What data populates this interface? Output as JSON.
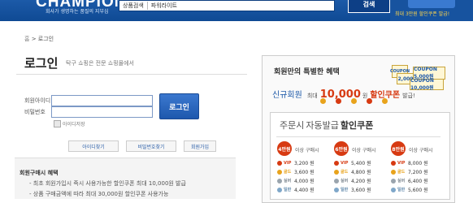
{
  "header": {
    "logo": "CHAMPION",
    "tagline": "회사가 생명하는 품질의 지부심",
    "search_category": "상품검색",
    "search_value": "파워라이트",
    "search_button": "검색",
    "promo_text": "최대 3만원 할인쿠폰 발급!"
  },
  "breadcrumb": {
    "home": "홈",
    "sep": ">",
    "current": "로그인"
  },
  "login": {
    "title": "로그인",
    "subtitle": "탁구 쇼핑은 전문 쇼핑몰에서",
    "id_label": "회원아이디",
    "pw_label": "비밀번호",
    "button": "로그인",
    "save_id": "아이디저장",
    "links": [
      "아이디찾기",
      "비밀번호찾기",
      "회원가입"
    ]
  },
  "benefit": {
    "title": "회원구매시 혜택",
    "lines": [
      "- 최초 회원가입시 즉시 사용가능한 할인쿠폰 최대 10,000원 발급",
      "- 상품 구매금액에 따라 최대 30,000원 할인쿠폰 사용가능"
    ]
  },
  "panel": {
    "title": "회원만의 특별한 혜택",
    "coupons": [
      "COUPON",
      "2,000",
      "COUPON 5,000원",
      "COUPON 10,000원"
    ],
    "new_member": "신규회원",
    "max": "최대",
    "amount": "10,000",
    "won": "원",
    "coupon": "할인쿠폰",
    "issue": "발급!",
    "order_title_1": "주문시",
    "order_title_2": "자동발급",
    "order_title_3": "할인쿠폰",
    "columns": [
      {
        "badge": "4만원",
        "cond": "이상 구매시",
        "rows": [
          [
            "VIP",
            "3,200 원"
          ],
          [
            "골드",
            "3,600 원"
          ],
          [
            "실버",
            "4,000 원"
          ],
          [
            "일반",
            "4,400 원"
          ]
        ]
      },
      {
        "badge": "6만원",
        "cond": "이상 구매시",
        "rows": [
          [
            "VIP",
            "5,400 원"
          ],
          [
            "골드",
            "4,800 원"
          ],
          [
            "실버",
            "4,200 원"
          ],
          [
            "일반",
            "3,600 원"
          ]
        ]
      },
      {
        "badge": "8만원",
        "cond": "이상 구매시",
        "rows": [
          [
            "VIP",
            "8,000 원"
          ],
          [
            "골드",
            "7,200 원"
          ],
          [
            "실버",
            "6,400 원"
          ],
          [
            "일반",
            "5,600 원"
          ]
        ]
      }
    ]
  },
  "colors": {
    "brand_blue": "#1c5aa8",
    "accent_red": "#d73a12",
    "grade": [
      "#d73a12",
      "#e8a31c",
      "#9aa4ad",
      "#7fa7c9"
    ]
  }
}
